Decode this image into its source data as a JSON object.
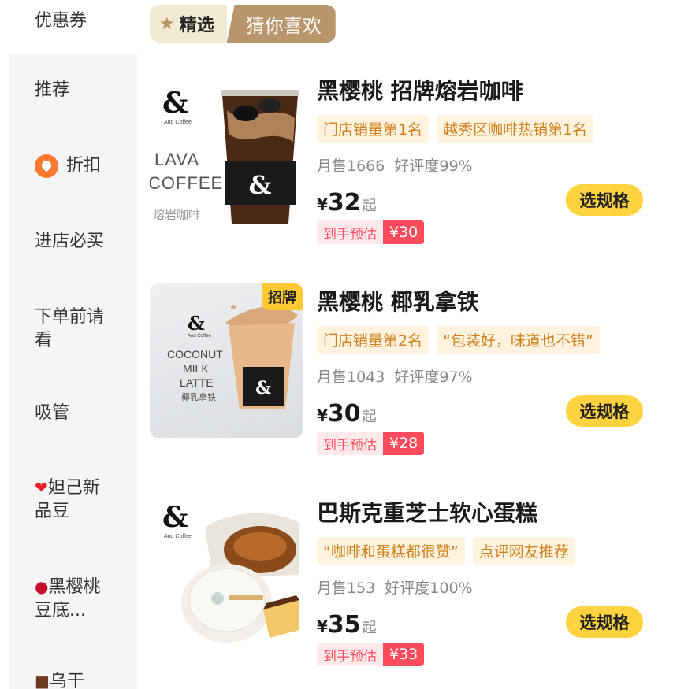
{
  "sidebar": {
    "top_item": "优惠券",
    "items": [
      {
        "label": "推荐",
        "icon": ""
      },
      {
        "label": "折扣",
        "icon": "discount-icon"
      },
      {
        "label": "进店必买",
        "icon": ""
      },
      {
        "label": "下单前请看",
        "icon": ""
      },
      {
        "label": "吸管",
        "icon": ""
      },
      {
        "label": "妲己新品豆",
        "icon": "heart-icon"
      },
      {
        "label": "黑樱桃豆底...",
        "icon": "cherry-icon"
      },
      {
        "label": "乌干",
        "icon": "chocolate-icon"
      }
    ]
  },
  "tabs": {
    "selected": "精选",
    "other": "猜你喜欢"
  },
  "products": [
    {
      "name": "黑樱桃 招牌熔岩咖啡",
      "tags": [
        "门店销量第1名",
        "越秀区咖啡热销第1名"
      ],
      "monthly_sales": "月售1666",
      "rating": "好评度99%",
      "currency": "¥",
      "price": "32",
      "price_suffix": "起",
      "estimate_label": "到手预估",
      "estimate_price": "¥30",
      "button": "选规格",
      "image": {
        "brand": "&",
        "brand_sub": "And Coffee",
        "line1": "LAVA",
        "line2": "COFFEE",
        "line3": "熔岩咖啡"
      }
    },
    {
      "name": "黑樱桃 椰乳拿铁",
      "tags": [
        "门店销量第2名",
        "“包装好，味道也不错”"
      ],
      "monthly_sales": "月售1043",
      "rating": "好评度97%",
      "currency": "¥",
      "price": "30",
      "price_suffix": "起",
      "estimate_label": "到手预估",
      "estimate_price": "¥28",
      "button": "选规格",
      "badge": "招牌",
      "image": {
        "brand": "&",
        "brand_sub": "And Coffee",
        "line1": "COCONUT",
        "line2": "MILK",
        "line3": "LATTE",
        "line4": "椰乳拿铁"
      }
    },
    {
      "name": "巴斯克重芝士软心蛋糕",
      "tags": [
        "“咖啡和蛋糕都很赞”",
        "点评网友推荐"
      ],
      "monthly_sales": "月售153",
      "rating": "好评度100%",
      "currency": "¥",
      "price": "35",
      "price_suffix": "起",
      "estimate_label": "到手预估",
      "estimate_price": "¥33",
      "button": "选规格",
      "image": {
        "brand": "&",
        "brand_sub": "And Coffee"
      }
    }
  ],
  "colors": {
    "accent_yellow": "#ffd23f",
    "tag_bg": "#fff3df",
    "tag_text": "#d0801a",
    "estimate_red": "#ff4b5c",
    "tab_gold": "#b8956a"
  }
}
